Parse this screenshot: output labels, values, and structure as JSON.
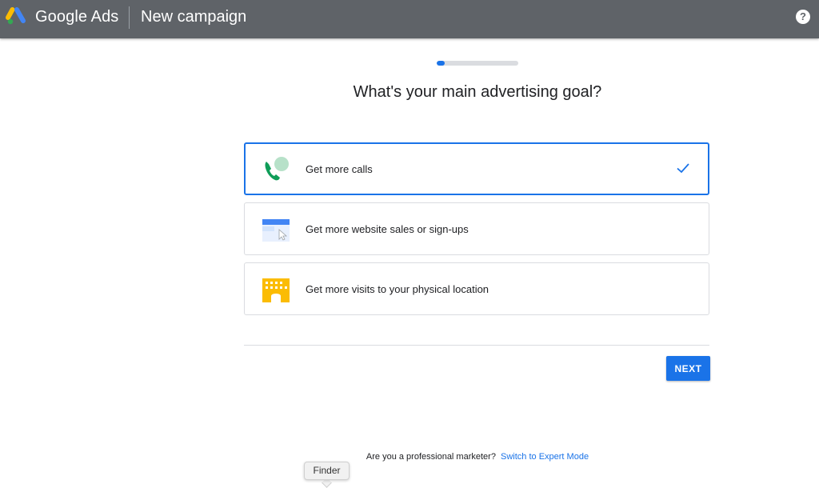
{
  "header": {
    "brand": "Google Ads",
    "page_title": "New campaign",
    "help_icon": "help-circle-icon",
    "help_glyph": "?"
  },
  "progress": {
    "step": 1,
    "fraction": 0.1
  },
  "main": {
    "question": "What's your main advertising goal?",
    "options": [
      {
        "label": "Get more calls",
        "icon": "phone-call-icon",
        "selected": true
      },
      {
        "label": "Get more website sales or sign-ups",
        "icon": "website-browser-icon",
        "selected": false
      },
      {
        "label": "Get more visits to your physical location",
        "icon": "storefront-building-icon",
        "selected": false
      }
    ],
    "next_label": "NEXT"
  },
  "footer": {
    "prompt": "Are you a professional marketer?",
    "link": "Switch to Expert Mode"
  },
  "tooltip": {
    "label": "Finder"
  },
  "colors": {
    "topbar": "#5f6368",
    "accent": "#1a73e8",
    "border": "#dadce0",
    "phone_green": "#0f9d58",
    "bubble_green": "#b7e1c9",
    "building_yellow": "#fbbc04"
  }
}
